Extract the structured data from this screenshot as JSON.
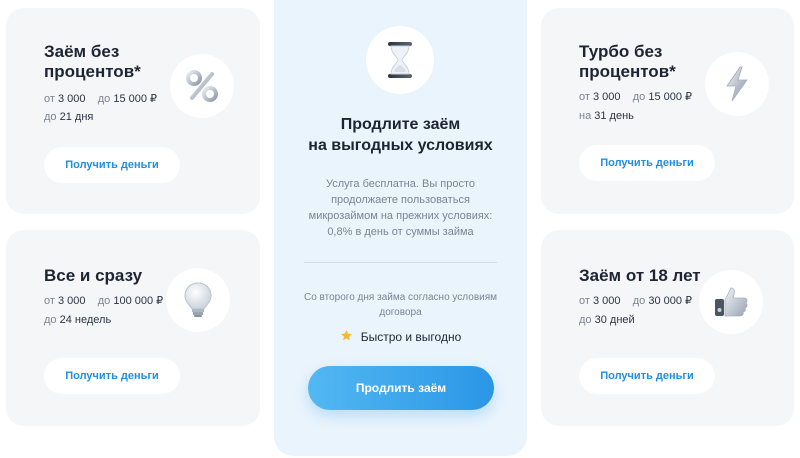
{
  "cards": [
    {
      "title": "Заём без процентов*",
      "from_label": "от",
      "from_value": "3 000",
      "to_label": "до",
      "to_value": "15 000 ₽",
      "term_label": "до",
      "term_value": "21 дня",
      "button": "Получить деньги",
      "icon": "percent-icon"
    },
    {
      "title": "Все и сразу",
      "from_label": "от",
      "from_value": "3 000",
      "to_label": "до",
      "to_value": "100 000 ₽",
      "term_label": "до",
      "term_value": "24 недель",
      "button": "Получить деньги",
      "icon": "lightbulb-icon"
    },
    {
      "title": "Турбо без процентов*",
      "from_label": "от",
      "from_value": "3 000",
      "to_label": "до",
      "to_value": "15 000 ₽",
      "term_label": "на",
      "term_value": "31 день",
      "button": "Получить деньги",
      "icon": "lightning-icon"
    },
    {
      "title": "Заём от 18 лет",
      "from_label": "от",
      "from_value": "3 000",
      "to_label": "до",
      "to_value": "30 000 ₽",
      "term_label": "до",
      "term_value": "30 дней",
      "button": "Получить деньги",
      "icon": "thumbs-up-icon"
    }
  ],
  "promo": {
    "icon": "hourglass-icon",
    "title": "Продлите заём\nна выгодных условиях",
    "description": "Услуга бесплатна. Вы просто\nпродолжаете пользоваться\nмикрозаймом на прежних условиях:\n0,8% в день от суммы займа",
    "note": "Со второго дня займа согласно условиям\nдоговора",
    "feature": "Быстро и выгодно",
    "feature_icon": "star-icon",
    "button": "Продлить заём"
  },
  "colors": {
    "accent": "#1e8fe1",
    "card_bg": "#f5f6f8",
    "promo_bg": "#eaf4fc",
    "star": "#f5b63a"
  }
}
